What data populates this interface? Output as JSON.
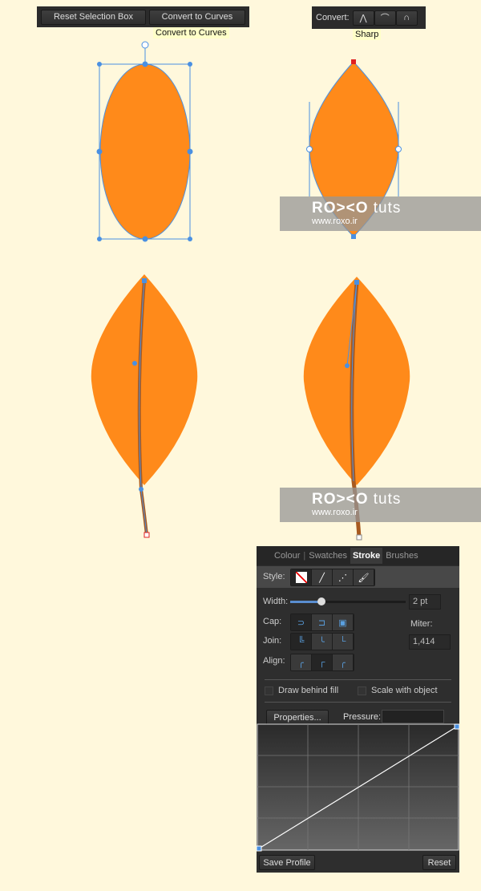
{
  "toolbar_left": {
    "buttons": [
      "Reset Selection Box",
      "Convert to Curves"
    ],
    "tooltip": "Convert to Curves"
  },
  "toolbar_right": {
    "label": "Convert:",
    "icons": [
      "sharp-node-icon",
      "smooth-node-icon",
      "smart-node-icon"
    ],
    "tooltip": "Sharp"
  },
  "watermark": {
    "brand": "RO><O",
    "suffix": "tuts",
    "url": "www.roxo.ir"
  },
  "colors": {
    "background": "#fff8dc",
    "leaf": "#ff8a1a",
    "selection": "#4a90e2",
    "stem": "#a85a20"
  },
  "panel": {
    "tabs": [
      "Colour",
      "Swatches",
      "Stroke",
      "Brushes"
    ],
    "active_tab": "Stroke",
    "style_label": "Style:",
    "width_label": "Width:",
    "width_value": "2 pt",
    "width_slider_fraction": 0.27,
    "cap_label": "Cap:",
    "join_label": "Join:",
    "align_label": "Align:",
    "miter_label": "Miter:",
    "miter_value": "1,414",
    "draw_behind_fill": "Draw behind fill",
    "scale_with_object": "Scale with object",
    "properties_button": "Properties...",
    "pressure_label": "Pressure:",
    "save_profile": "Save Profile",
    "reset": "Reset"
  }
}
